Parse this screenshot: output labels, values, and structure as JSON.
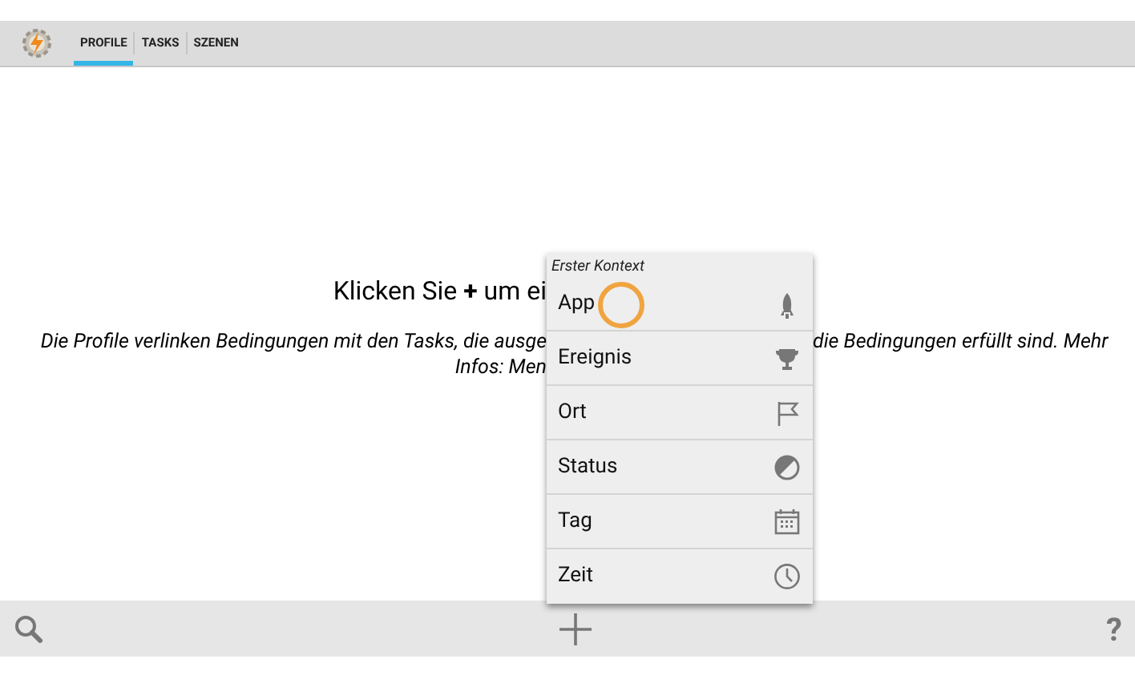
{
  "tabs": [
    {
      "label": "PROFILE",
      "selected": true
    },
    {
      "label": "TASKS",
      "selected": false
    },
    {
      "label": "SZENEN",
      "selected": false
    }
  ],
  "empty_state": {
    "heading": "Klicken Sie **+** um ei",
    "description_left": "Die Profile verlinken Bedingungen mit den Tasks, die ausge",
    "description_right": "die Bedingungen erfüllt sind. Mehr",
    "description_line_2": "Infos: Men"
  },
  "context_menu": {
    "title": "Erster Kontext",
    "items": [
      {
        "label": "App",
        "kind": "app"
      },
      {
        "label": "Ereignis",
        "kind": "event"
      },
      {
        "label": "Ort",
        "kind": "location"
      },
      {
        "label": "Status",
        "kind": "state"
      },
      {
        "label": "Tag",
        "kind": "day"
      },
      {
        "label": "Zeit",
        "kind": "time"
      }
    ]
  },
  "bottom_bar": {
    "help_label": "?"
  }
}
